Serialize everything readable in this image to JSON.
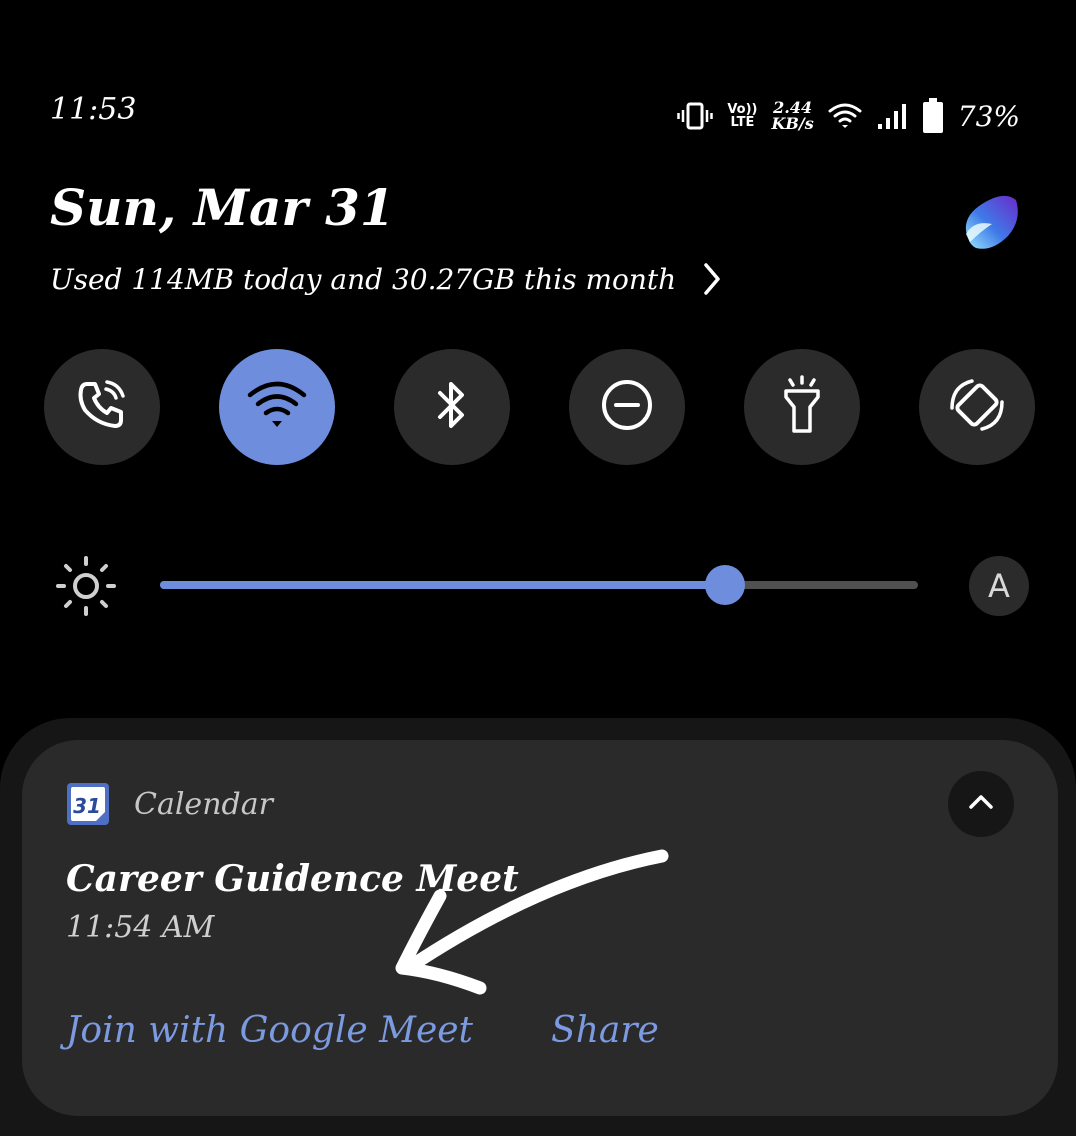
{
  "status_bar": {
    "time": "11:53",
    "network_type": [
      "Vo))",
      "LTE"
    ],
    "speed_value": "2.44",
    "speed_unit": "KB/s",
    "battery_percent": "73%",
    "icons": [
      "vibrate-icon",
      "volte-icon",
      "wifi-icon",
      "signal-icon",
      "battery-icon"
    ]
  },
  "header": {
    "date": "Sun, Mar 31",
    "data_usage": "Used 114MB today and 30.27GB this month"
  },
  "quick_tiles": [
    {
      "name": "call",
      "icon": "wifi-calling-icon",
      "active": false
    },
    {
      "name": "wifi",
      "icon": "wifi-icon",
      "active": true
    },
    {
      "name": "bluetooth",
      "icon": "bluetooth-icon",
      "active": false
    },
    {
      "name": "do-not-disturb",
      "icon": "do-not-disturb-icon",
      "active": false
    },
    {
      "name": "flashlight",
      "icon": "flashlight-icon",
      "active": false
    },
    {
      "name": "auto-rotate",
      "icon": "auto-rotate-icon",
      "active": false
    }
  ],
  "brightness": {
    "level": 0.745,
    "auto_label": "A"
  },
  "notification": {
    "app_icon_text": "31",
    "app_name": "Calendar",
    "event_title": "Career Guidence Meet",
    "event_time": "11:54 AM",
    "actions": [
      "Join with Google Meet",
      "Share"
    ]
  },
  "colors": {
    "accent": "#6e8ddd",
    "action_text": "#7b9ae0",
    "tile_bg": "#2b2b2b",
    "card_bg": "#2a2a2a",
    "background": "#000000"
  }
}
